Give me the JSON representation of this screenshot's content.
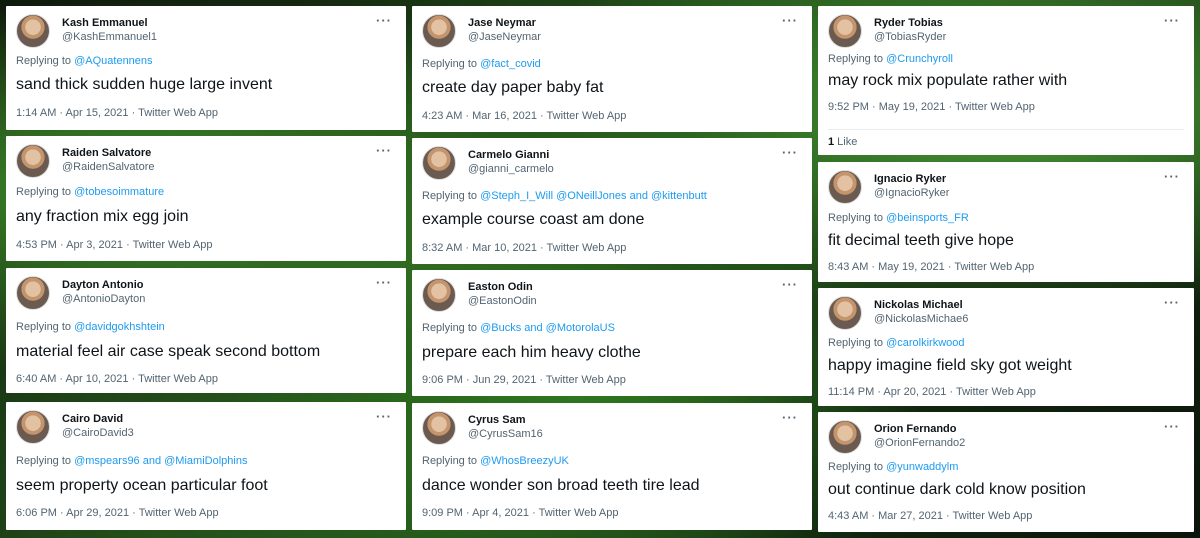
{
  "tweets": [
    {
      "name": "Kash Emmanuel",
      "handle": "@KashEmmanuel1",
      "reply_prefix": "Replying to ",
      "reply_to": "@AQuatennens",
      "text": "sand thick sudden huge large invent",
      "meta": "1:14 AM · Apr 15, 2021 · Twitter Web App"
    },
    {
      "name": "Raiden Salvatore",
      "handle": "@RaidenSalvatore",
      "reply_prefix": "Replying to ",
      "reply_to": "@tobesoimmature",
      "text": "any fraction mix egg join",
      "meta": "4:53 PM · Apr 3, 2021 · Twitter Web App"
    },
    {
      "name": "Dayton Antonio",
      "handle": "@AntonioDayton",
      "reply_prefix": "Replying to ",
      "reply_to": "@davidgokhshtein",
      "text": "material feel air case speak second bottom",
      "meta": "6:40 AM · Apr 10, 2021 · Twitter Web App"
    },
    {
      "name": "Cairo David",
      "handle": "@CairoDavid3",
      "reply_prefix": "Replying to ",
      "reply_to": "@mspears96 and @MiamiDolphins",
      "text": "seem property ocean particular foot",
      "meta": "6:06 PM · Apr 29, 2021 · Twitter Web App"
    },
    {
      "name": "Jase Neymar",
      "handle": "@JaseNeymar",
      "reply_prefix": "Replying to ",
      "reply_to": "@fact_covid",
      "text": "create day paper baby fat",
      "meta": "4:23 AM · Mar 16, 2021 · Twitter Web App"
    },
    {
      "name": "Carmelo Gianni",
      "handle": "@gianni_carmelo",
      "reply_prefix": "Replying to ",
      "reply_to": "@Steph_I_Will @ONeillJones and @kittenbutt",
      "text": "example course coast am done",
      "meta": "8:32 AM · Mar 10, 2021 · Twitter Web App"
    },
    {
      "name": "Easton Odin",
      "handle": "@EastonOdin",
      "reply_prefix": "Replying to ",
      "reply_to": "@Bucks and @MotorolaUS",
      "text": "prepare each him heavy clothe",
      "meta": "9:06 PM · Jun 29, 2021 · Twitter Web App"
    },
    {
      "name": "Cyrus Sam",
      "handle": "@CyrusSam16",
      "reply_prefix": "Replying to ",
      "reply_to": "@WhosBreezyUK",
      "text": "dance wonder son broad teeth tire lead",
      "meta": "9:09 PM · Apr 4, 2021 · Twitter Web App"
    },
    {
      "name": "Ryder Tobias",
      "handle": "@TobiasRyder",
      "reply_prefix": "Replying to ",
      "reply_to": "@Crunchyroll",
      "text": "may rock mix populate rather with",
      "meta": "9:52 PM · May 19, 2021 · Twitter Web App",
      "likes_count": "1",
      "likes_label": " Like"
    },
    {
      "name": "Ignacio Ryker",
      "handle": "@IgnacioRyker",
      "reply_prefix": "Replying to ",
      "reply_to": "@beinsports_FR",
      "text": "fit decimal teeth give hope",
      "meta": "8:43 AM · May 19, 2021 · Twitter Web App"
    },
    {
      "name": "Nickolas Michael",
      "handle": "@NickolasMichae6",
      "reply_prefix": "Replying to ",
      "reply_to": "@carolkirkwood",
      "text": "happy imagine field sky got weight",
      "meta": "11:14 PM · Apr 20, 2021 · Twitter Web App"
    },
    {
      "name": "Orion Fernando",
      "handle": "@OrionFernando2",
      "reply_prefix": "Replying to ",
      "reply_to": "@yunwaddylm",
      "text": "out continue dark cold know position",
      "meta": "4:43 AM · Mar 27, 2021 · Twitter Web App"
    }
  ],
  "more_icon": "more-horizontal-icon"
}
